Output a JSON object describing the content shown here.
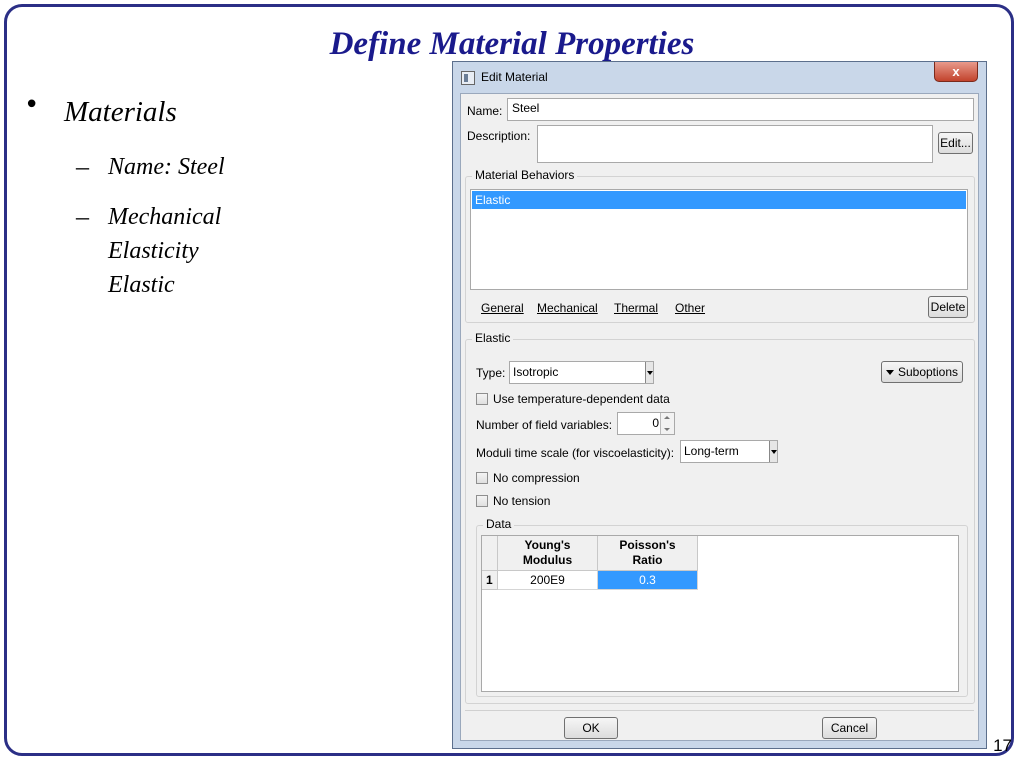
{
  "slide": {
    "title": "Define Material Properties",
    "bullet_char": "•",
    "dash_char": "–",
    "bullet_1": "Materials",
    "sub_1": "Name: Steel",
    "sub_2_lines": [
      "Mechanical",
      "Elasticity",
      "Elastic"
    ],
    "page_number": "17",
    "border_color": "#2b2f86",
    "title_color": "#1a1a8c"
  },
  "dialog": {
    "title": "Edit Material",
    "close_label": "x",
    "name_label": "Name:",
    "name_value": "Steel",
    "description_label": "Description:",
    "description_value": "",
    "edit_button": "Edit...",
    "behaviors_group": "Material Behaviors",
    "behaviors": [
      "Elastic"
    ],
    "menus": [
      "General",
      "Mechanical",
      "Thermal",
      "Other"
    ],
    "delete_button": "Delete",
    "elastic_group": "Elastic",
    "type_label": "Type:",
    "type_value": "Isotropic",
    "suboptions_button": "Suboptions",
    "temp_dependent_label": "Use temperature-dependent data",
    "field_vars_label": "Number of field variables:",
    "field_vars_value": "0",
    "moduli_label": "Moduli time scale (for viscoelasticity):",
    "moduli_value": "Long-term",
    "no_compression_label": "No compression",
    "no_tension_label": "No tension",
    "data_group": "Data",
    "table": {
      "columns": [
        {
          "line1": "Young's",
          "line2": "Modulus"
        },
        {
          "line1": "Poisson's",
          "line2": "Ratio"
        }
      ],
      "rows": [
        {
          "index": "1",
          "cells": [
            "200E9",
            "0.3"
          ]
        }
      ]
    },
    "ok_button": "OK",
    "cancel_button": "Cancel",
    "selection_color": "#3399ff"
  }
}
